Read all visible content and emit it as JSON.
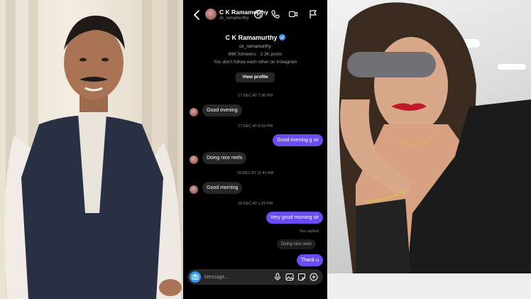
{
  "header": {
    "name": "C K Ramamurthy",
    "username": "ck_ramamurthy"
  },
  "profile": {
    "name": "C K Ramamurthy",
    "username": "ck_ramamurthy",
    "stats": "66K followers · 2.3K posts",
    "follow_status": "You don't follow each other on Instagram",
    "view_profile_label": "View profile"
  },
  "chat": {
    "ts1": "17 DEC AT 7:36 PM",
    "msg1": "Good evening",
    "ts2": "17 DEC AT 8:59 PM",
    "msg2": "Good evening g sir",
    "msg3": "Doing nice reels",
    "ts3": "18 DEC AT 11:41 AM",
    "msg4": "Good morning",
    "ts4": "18 DEC AT 1:29 PM",
    "msg5": "Very good morning sir",
    "replied_label": "You replied",
    "reply_quote": "Doing nice reels",
    "msg6": "Thank u"
  },
  "composer": {
    "placeholder": "Message..."
  },
  "colors": {
    "outgoing_bubble": "#6b4cf0",
    "incoming_bubble": "#262626",
    "verified": "#3797f0",
    "background": "#000000"
  },
  "icons": [
    "back-icon",
    "call-link-icon",
    "phone-icon",
    "video-icon",
    "flag-icon",
    "camera-icon",
    "mic-icon",
    "gallery-icon",
    "sticker-icon",
    "plus-icon"
  ]
}
